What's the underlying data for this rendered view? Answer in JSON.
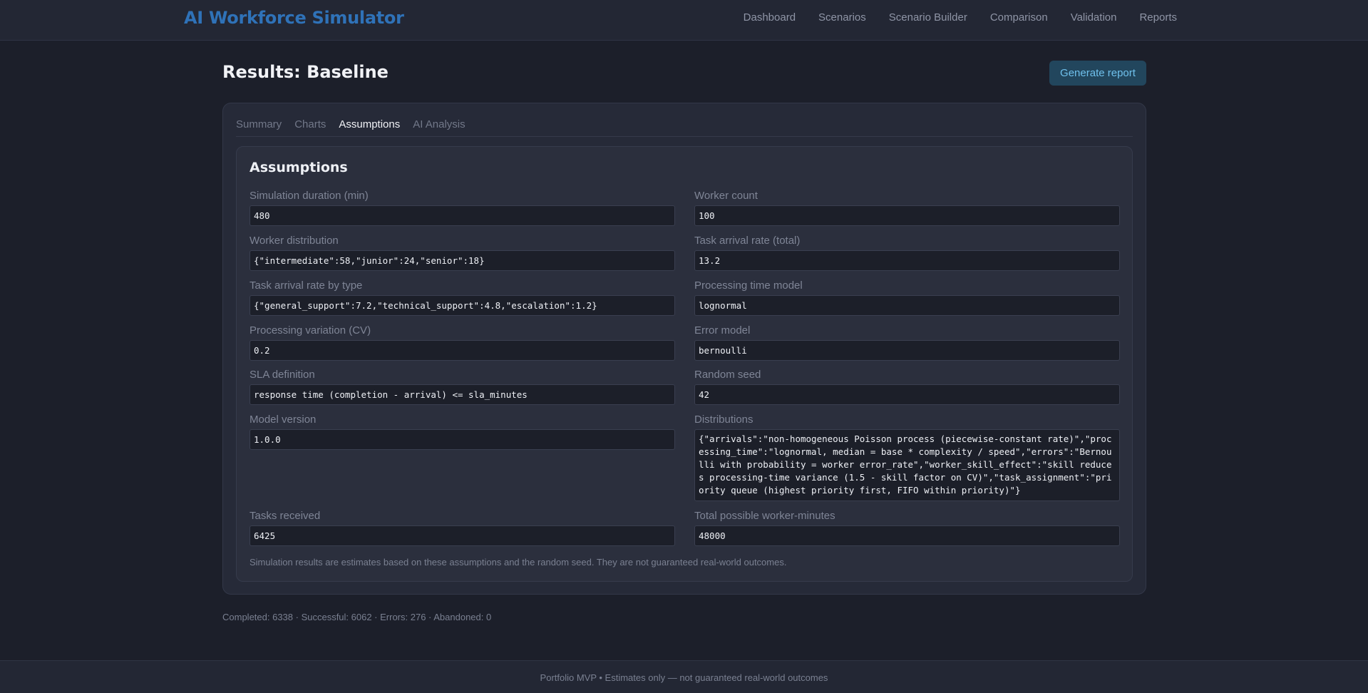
{
  "app": {
    "title": "AI Workforce Simulator"
  },
  "nav": [
    "Dashboard",
    "Scenarios",
    "Scenario Builder",
    "Comparison",
    "Validation",
    "Reports"
  ],
  "page": {
    "title": "Results: Baseline",
    "generate_report_label": "Generate report"
  },
  "tabs": [
    "Summary",
    "Charts",
    "Assumptions",
    "AI Analysis"
  ],
  "active_tab": "Assumptions",
  "assumptions": {
    "title": "Assumptions",
    "fields": {
      "sim_duration": {
        "label": "Simulation duration (min)",
        "value": "480"
      },
      "worker_count": {
        "label": "Worker count",
        "value": "100"
      },
      "worker_distribution": {
        "label": "Worker distribution",
        "value": "{\"intermediate\":58,\"junior\":24,\"senior\":18}"
      },
      "task_arrival_total": {
        "label": "Task arrival rate (total)",
        "value": "13.2"
      },
      "task_arrival_by_type": {
        "label": "Task arrival rate by type",
        "value": "{\"general_support\":7.2,\"technical_support\":4.8,\"escalation\":1.2}"
      },
      "processing_time_model": {
        "label": "Processing time model",
        "value": "lognormal"
      },
      "processing_variation": {
        "label": "Processing variation (CV)",
        "value": "0.2"
      },
      "error_model": {
        "label": "Error model",
        "value": "bernoulli"
      },
      "sla_definition": {
        "label": "SLA definition",
        "value": "response time (completion - arrival) <= sla_minutes"
      },
      "random_seed": {
        "label": "Random seed",
        "value": "42"
      },
      "model_version": {
        "label": "Model version",
        "value": "1.0.0"
      },
      "distributions": {
        "label": "Distributions",
        "value": "{\"arrivals\":\"non-homogeneous Poisson process (piecewise-constant rate)\",\"processing_time\":\"lognormal, median = base * complexity / speed\",\"errors\":\"Bernoulli with probability = worker error_rate\",\"worker_skill_effect\":\"skill reduces processing-time variance (1.5 - skill factor on CV)\",\"task_assignment\":\"priority queue (highest priority first, FIFO within priority)\"}"
      },
      "tasks_received": {
        "label": "Tasks received",
        "value": "6425"
      },
      "total_worker_minutes": {
        "label": "Total possible worker-minutes",
        "value": "48000"
      }
    },
    "disclaimer": "Simulation results are estimates based on these assumptions and the random seed. They are not guaranteed real-world outcomes."
  },
  "stats_line": "Completed: 6338 · Successful: 6062 · Errors: 276 · Abandoned: 0",
  "footer": "Portfolio MVP • Estimates only — not guaranteed real-world outcomes",
  "colors": {
    "brand": "#2f72b8",
    "accent_button_bg": "#22465d",
    "accent_button_text": "#6fc0ec",
    "background": "#1c1f2a"
  }
}
